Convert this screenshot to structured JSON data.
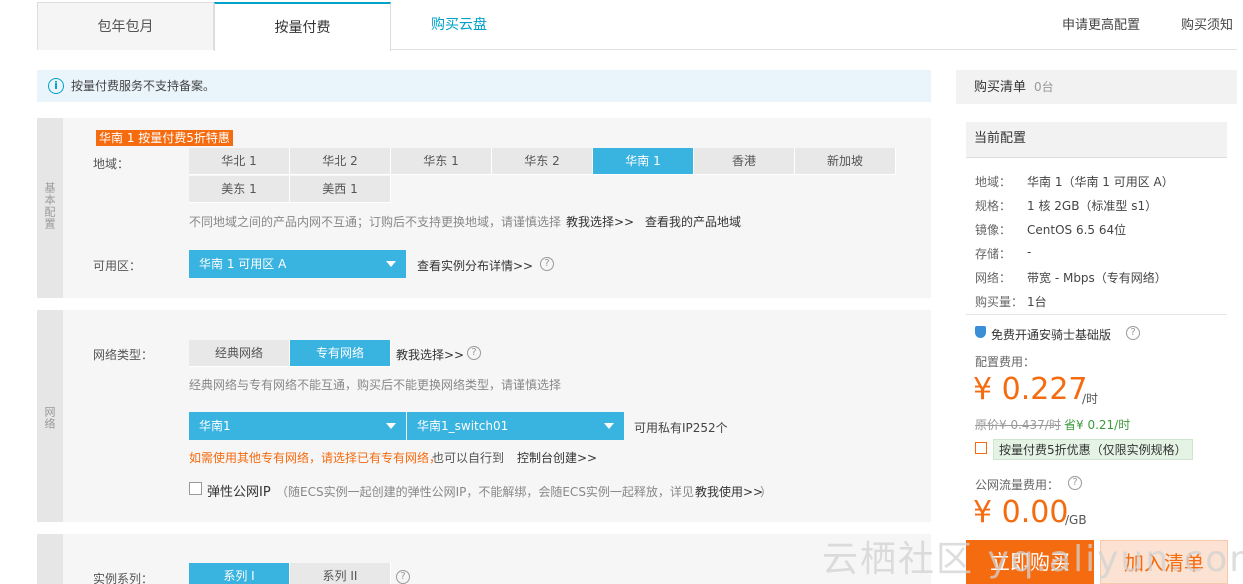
{
  "tabs": {
    "monthly": "包年包月",
    "payg": "按量付费",
    "cloud_disk": "购买云盘",
    "upgrade": "申请更高配置",
    "notice": "购买须知"
  },
  "info": {
    "text": "按量付费服务不支持备案。",
    "icon": "i"
  },
  "basic": {
    "side_label": "基本配置",
    "promo": "华南 1 按量付费5折特惠",
    "region_label": "地域：",
    "regions": [
      "华北 1",
      "华北 2",
      "华东 1",
      "华东 2",
      "华南 1",
      "香港",
      "新加坡",
      "美东 1",
      "美西 1"
    ],
    "selected_region": "华南 1",
    "region_hint": "不同地域之间的产品内网不互通；订购后不支持更换地域，请谨慎选择",
    "help_link": "教我选择>>",
    "my_regions_link": "查看我的产品地域",
    "zone_label": "可用区：",
    "zone_value": "华南 1 可用区 A",
    "zone_link": "查看实例分布详情>>"
  },
  "network": {
    "side_label": "网络",
    "type_label": "网络类型：",
    "classic": "经典网络",
    "vpc": "专有网络",
    "help_link": "教我选择>>",
    "hint": "经典网络与专有网络不能互通，购买后不能更换网络类型，请谨慎选择",
    "vpc_value": "华南1",
    "switch_value": "华南1_switch01",
    "ip_available": "可用私有IP252个",
    "warn": "如需使用其他专有网络，请选择已有专有网络，",
    "warn_tail": "也可以自行到",
    "console_link": "控制台创建>>",
    "eip_label": "弹性公网IP",
    "eip_desc": "（随ECS实例一起创建的弹性公网IP，不能解绑，会随ECS实例一起释放，详见",
    "eip_link": "教我使用>>",
    "eip_close": "）"
  },
  "instance": {
    "series_label": "实例系列：",
    "series1": "系列 I",
    "series2": "系列 II"
  },
  "cart": {
    "title": "购买清单",
    "count": "0台",
    "config_title": "当前配置",
    "rows": [
      {
        "k": "地域：",
        "v": "华南 1（华南 1 可用区 A）"
      },
      {
        "k": "规格：",
        "v": "1 核 2GB（标准型 s1）"
      },
      {
        "k": "镜像：",
        "v": "CentOS 6.5 64位"
      },
      {
        "k": "存储：",
        "v": "-"
      },
      {
        "k": "网络：",
        "v": "带宽 - Mbps（专有网络）"
      },
      {
        "k": "购买量：",
        "v": "1台"
      }
    ],
    "security": "免费开通安骑士基础版",
    "fee_label": "配置费用：",
    "price": "¥ 0.227",
    "unit": "/时",
    "orig": "原价¥ 0.437/时",
    "save": "省¥ 0.21/时",
    "discount": "按量付费5折优惠（仅限实例规格）",
    "traffic_label": "公网流量费用：",
    "traffic_price": "¥ 0.00",
    "traffic_unit": "/GB",
    "buy": "立即购买",
    "add": "加入清单"
  },
  "watermark": "云栖社区 yq.aliyun.com"
}
